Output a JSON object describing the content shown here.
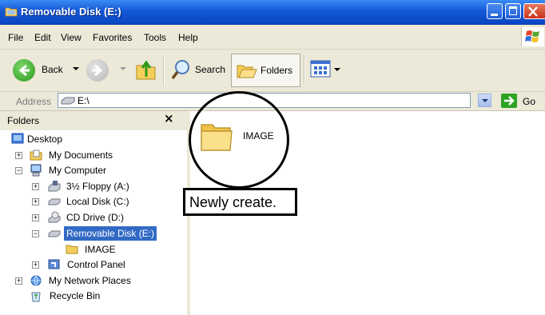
{
  "window": {
    "title": "Removable Disk (E:)"
  },
  "menu": [
    "File",
    "Edit",
    "View",
    "Favorites",
    "Tools",
    "Help"
  ],
  "toolbar": {
    "back_label": "Back",
    "search_label": "Search",
    "folders_label": "Folders"
  },
  "address": {
    "label": "Address",
    "value": "E:\\",
    "go_label": "Go"
  },
  "folders_pane": {
    "title": "Folders",
    "close_glyph": "×",
    "tree": [
      {
        "label": "Desktop",
        "icon": "desktop-icon",
        "expander": ""
      },
      {
        "label": "My Documents",
        "icon": "my-documents-icon",
        "expander": "+"
      },
      {
        "label": "My Computer",
        "icon": "my-computer-icon",
        "expander": "−"
      },
      {
        "label": "3½ Floppy (A:)",
        "icon": "floppy-drive-icon",
        "expander": "+"
      },
      {
        "label": "Local Disk (C:)",
        "icon": "hard-disk-icon",
        "expander": "+"
      },
      {
        "label": "CD Drive (D:)",
        "icon": "cd-drive-icon",
        "expander": "+"
      },
      {
        "label": "Removable Disk (E:)",
        "icon": "removable-disk-icon",
        "expander": "−",
        "selected": true
      },
      {
        "label": "IMAGE",
        "icon": "folder-icon",
        "expander": ""
      },
      {
        "label": "Control Panel",
        "icon": "control-panel-icon",
        "expander": "+"
      },
      {
        "label": "My Network Places",
        "icon": "network-places-icon",
        "expander": "+"
      },
      {
        "label": "Recycle Bin",
        "icon": "recycle-bin-icon",
        "expander": ""
      }
    ]
  },
  "content": {
    "items": [
      {
        "label": "IMAGE",
        "icon": "folder-icon"
      }
    ]
  },
  "annotation": {
    "callout_text": "Newly create."
  },
  "colors": {
    "titlebar": "#0a46c2",
    "selection": "#316ac5",
    "chrome": "#ece9d8"
  }
}
